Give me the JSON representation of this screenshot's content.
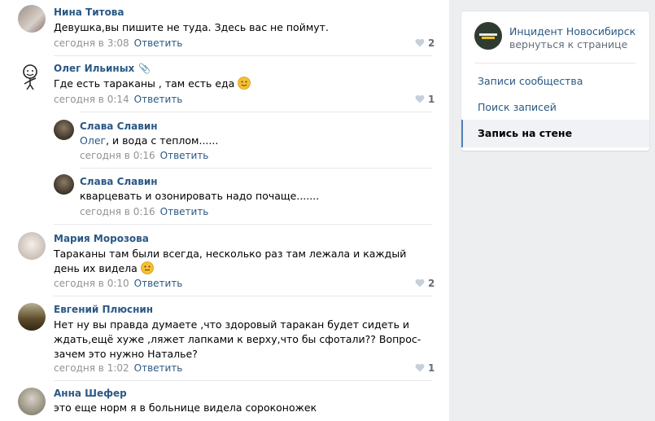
{
  "comments": [
    {
      "author": "Нина Титова",
      "text": "Девушка,вы пишите не туда. Здесь вас не поймут.",
      "time": "сегодня в 3:08",
      "reply": "Ответить",
      "likes": "2"
    },
    {
      "author": "Олег Ильиных",
      "text": "Где есть тараканы , там есть еда",
      "time": "сегодня в 0:14",
      "reply": "Ответить",
      "likes": "1"
    },
    {
      "author": "Слава Славин",
      "mention": "Олег",
      "text": ", и вода с теплом......",
      "time": "сегодня в 0:16",
      "reply": "Ответить"
    },
    {
      "author": "Слава Славин",
      "text": "кварцевать и озонировать надо почаще.......",
      "time": "сегодня в 0:16",
      "reply": "Ответить"
    },
    {
      "author": "Мария Морозова",
      "text": "Тараканы там были всегда, несколько раз там лежала и каждый день их видела",
      "time": "сегодня в 0:10",
      "reply": "Ответить",
      "likes": "2"
    },
    {
      "author": "Евгений Плюснин",
      "text": "Нет ну вы правда думаете ,что здоровый таракан будет сидеть и ждать,ещё хуже ,ляжет лапками к верху,что бы сфотали?? Вопрос-зачем это нужно Наталье?",
      "time": "сегодня в 1:02",
      "reply": "Ответить",
      "likes": "1"
    },
    {
      "author": "Анна Шефер",
      "text": "это еще норм я в больнице видела сороконожек"
    }
  ],
  "sidebar": {
    "group_name": "Инцидент Новосибирск",
    "back_label": "вернуться к странице",
    "menu": [
      "Записи сообщества",
      "Поиск записей",
      "Запись на стене"
    ]
  },
  "colors": {
    "link": "#2a5885",
    "meta": "#939393",
    "background": "#edeef0",
    "active_marker": "#5181b8"
  }
}
